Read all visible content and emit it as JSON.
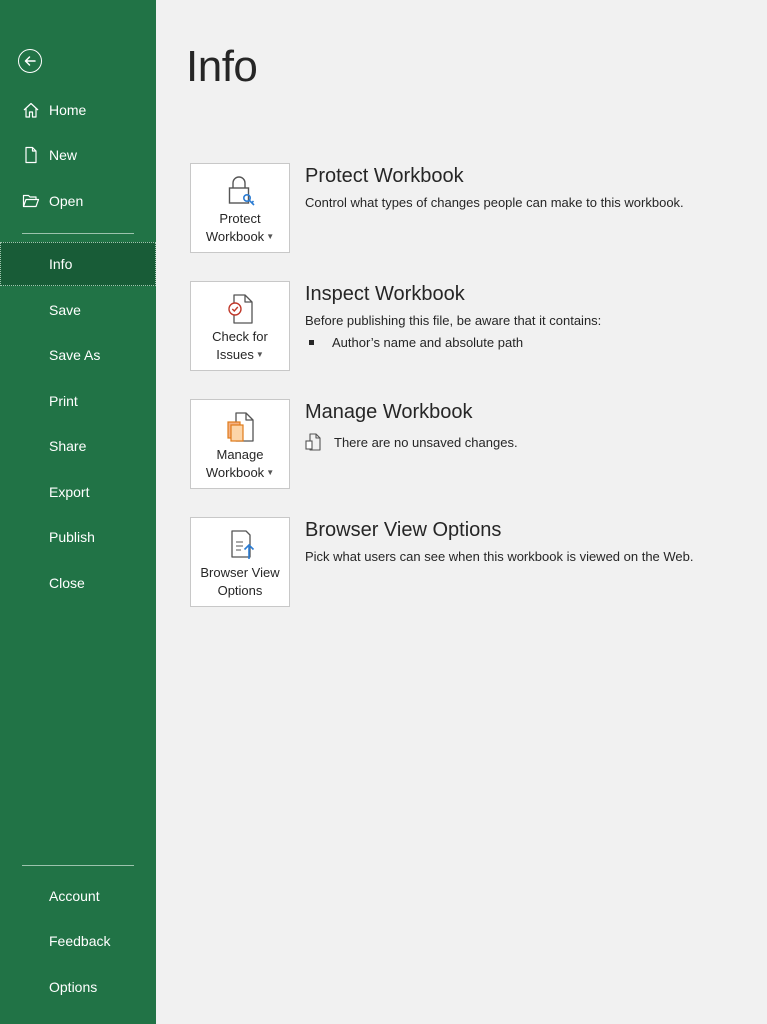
{
  "sidebar": {
    "back_icon": "arrow-left-circle-icon",
    "items": [
      {
        "label": "Home",
        "icon": "home-icon"
      },
      {
        "label": "New",
        "icon": "new-document-icon"
      },
      {
        "label": "Open",
        "icon": "folder-open-icon"
      },
      {
        "label": "Info",
        "active": true
      },
      {
        "label": "Save"
      },
      {
        "label": "Save As"
      },
      {
        "label": "Print"
      },
      {
        "label": "Share"
      },
      {
        "label": "Export"
      },
      {
        "label": "Publish"
      },
      {
        "label": "Close"
      }
    ],
    "bottom_items": [
      {
        "label": "Account"
      },
      {
        "label": "Feedback"
      },
      {
        "label": "Options"
      }
    ],
    "colors": {
      "background": "#217346",
      "active": "#185c37"
    }
  },
  "main": {
    "title": "Info",
    "sections": [
      {
        "tile_label_1": "Protect",
        "tile_label_2": "Workbook",
        "tile_icon": "lock-key-icon",
        "title": "Protect Workbook",
        "description": "Control what types of changes people can make to this workbook."
      },
      {
        "tile_label_1": "Check for",
        "tile_label_2": "Issues",
        "tile_icon": "document-check-icon",
        "title": "Inspect Workbook",
        "description": "Before publishing this file, be aware that it contains:",
        "bullets": [
          "Author’s name and absolute path"
        ]
      },
      {
        "tile_label_1": "Manage",
        "tile_label_2": "Workbook",
        "tile_icon": "document-versions-icon",
        "title": "Manage Workbook",
        "status": "There are no unsaved changes.",
        "status_icon": "document-icon"
      },
      {
        "tile_label_1": "Browser View",
        "tile_label_2": "Options",
        "tile_icon": "browser-view-icon",
        "title": "Browser View Options",
        "description": "Pick what users can see when this workbook is viewed on the Web."
      }
    ]
  }
}
